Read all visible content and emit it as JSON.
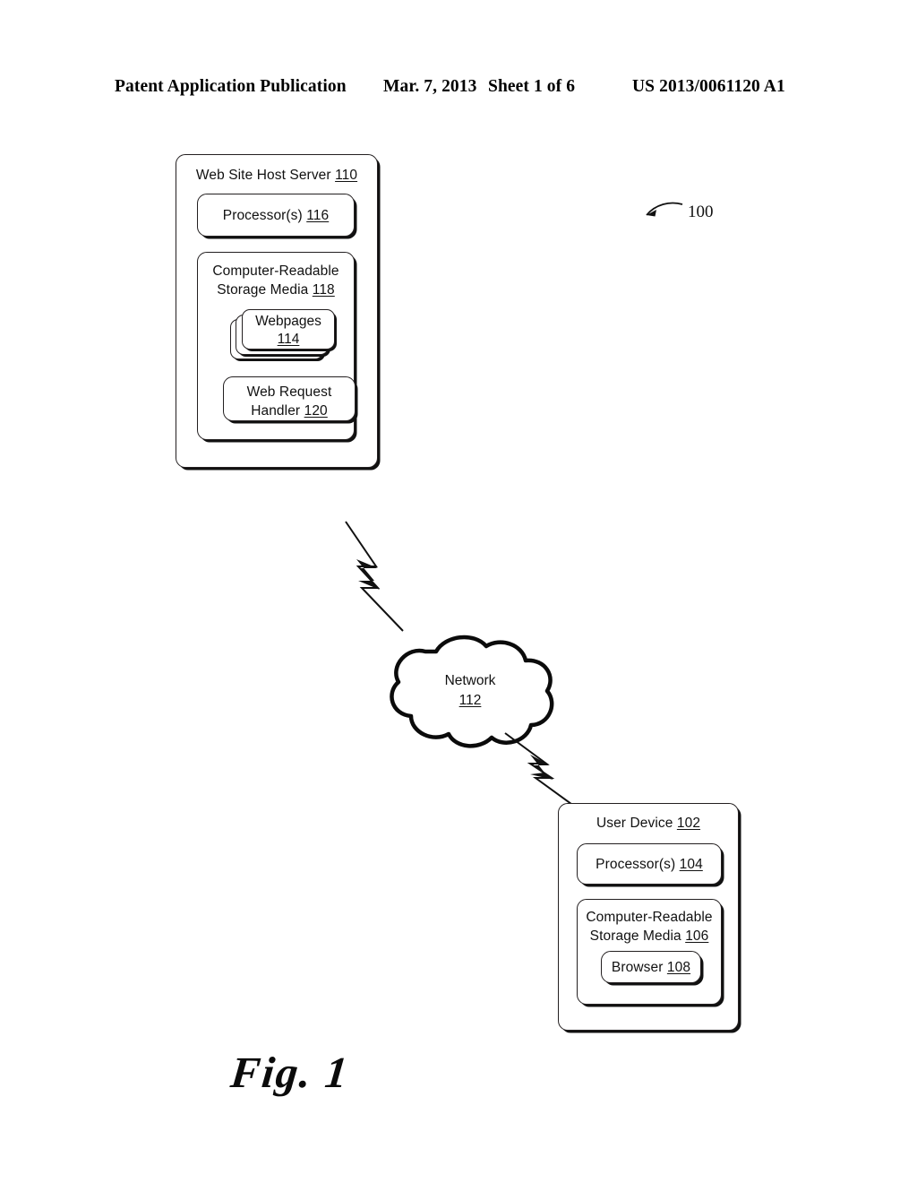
{
  "header": {
    "publication": "Patent Application Publication",
    "date": "Mar. 7, 2013",
    "sheet": "Sheet 1 of 6",
    "patent_number": "US 2013/0061120 A1"
  },
  "figure": {
    "caption": "Fig. 1",
    "system_reference": "100"
  },
  "server": {
    "title": "Web Site Host Server 110",
    "title_text": "Web Site Host Server",
    "title_ref": "110",
    "processor": {
      "text": "Processor(s)",
      "ref": "116"
    },
    "storage": {
      "line1": "Computer-Readable",
      "line2_text": "Storage Media",
      "line2_ref": "118"
    },
    "webpages": {
      "line1": "Webpages",
      "ref": "114",
      "stack_count": 3
    },
    "request_handler": {
      "line1": "Web Request",
      "line2_text": "Handler",
      "line2_ref": "120"
    }
  },
  "network": {
    "label": "Network",
    "ref": "112"
  },
  "device": {
    "title_text": "User Device",
    "title_ref": "102",
    "processor": {
      "text": "Processor(s)",
      "ref": "104"
    },
    "storage": {
      "line1": "Computer-Readable",
      "line2_text": "Storage Media",
      "line2_ref": "106"
    },
    "browser": {
      "text": "Browser",
      "ref": "108"
    }
  },
  "connectors": [
    {
      "name": "server-to-network-lightning",
      "from": "Web Site Host Server 110",
      "to": "Network 112"
    },
    {
      "name": "network-to-device-lightning",
      "from": "Network 112",
      "to": "User Device 102"
    }
  ],
  "colors": {
    "ink": "#231f20",
    "background": "#ffffff"
  }
}
